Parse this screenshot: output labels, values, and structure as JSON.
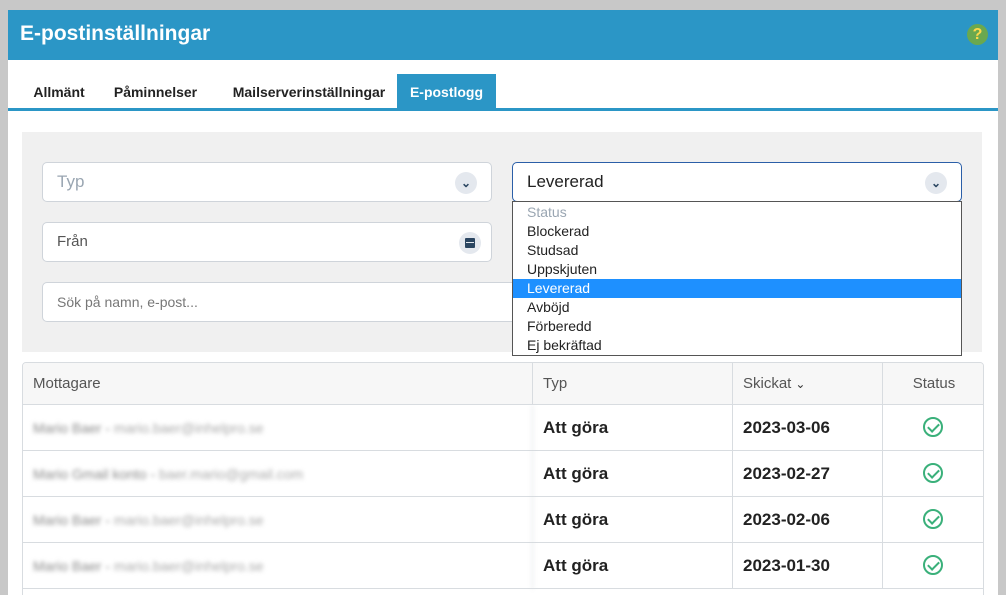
{
  "header": {
    "title": "E-postinställningar",
    "help_label": "?"
  },
  "tabs": [
    {
      "label": "Allmänt"
    },
    {
      "label": "Påminnelser"
    },
    {
      "label": "Mailserverinställningar"
    },
    {
      "label": "E-postlogg"
    }
  ],
  "active_tab": "E-postlogg",
  "filters": {
    "type_placeholder": "Typ",
    "from_placeholder": "Från",
    "search_placeholder": "Sök på namn, e-post...",
    "status_value": "Levererad"
  },
  "status_dropdown": {
    "options": [
      "Status",
      "Blockerad",
      "Studsad",
      "Uppskjuten",
      "Levererad",
      "Avböjd",
      "Förberedd",
      "Ej bekräftad"
    ],
    "selected": "Levererad"
  },
  "table": {
    "columns": [
      "Mottagare",
      "Typ",
      "Skickat",
      "Status"
    ],
    "rows": [
      {
        "name": "Mario Baer",
        "email": "mario.baer@inhelpro.se",
        "type": "Att göra",
        "sent": "2023-03-06",
        "status": "check-icon"
      },
      {
        "name": "Mario Gmail konto",
        "email": "baer.mario@gmail.com",
        "type": "Att göra",
        "sent": "2023-02-27",
        "status": "check-icon"
      },
      {
        "name": "Mario Baer",
        "email": "mario.baer@inhelpro.se",
        "type": "Att göra",
        "sent": "2023-02-06",
        "status": "check-icon"
      },
      {
        "name": "Mario Baer",
        "email": "mario.baer@inhelpro.se",
        "type": "Att göra",
        "sent": "2023-01-30",
        "status": "check-icon"
      }
    ]
  },
  "colors": {
    "accent": "#2b96c6",
    "success": "#3ab07a",
    "selected": "#1e90ff"
  }
}
